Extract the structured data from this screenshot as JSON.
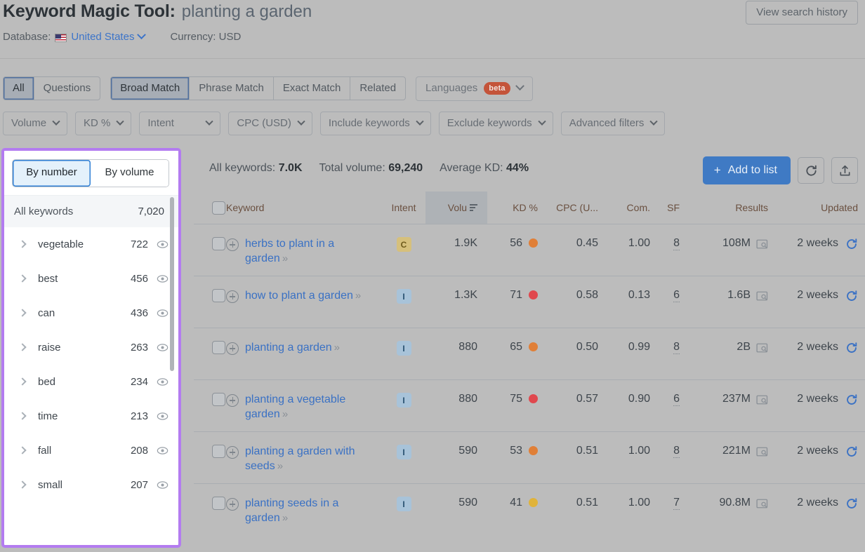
{
  "header": {
    "title_main": "Keyword Magic Tool:",
    "title_query": "planting a garden",
    "view_history_label": "View search history",
    "database_label": "Database:",
    "database_value": "United States",
    "currency_label": "Currency: USD"
  },
  "tabs": {
    "group1": [
      {
        "label": "All",
        "selected": true
      },
      {
        "label": "Questions",
        "selected": false
      }
    ],
    "group2": [
      {
        "label": "Broad Match",
        "selected": true
      },
      {
        "label": "Phrase Match",
        "selected": false
      },
      {
        "label": "Exact Match",
        "selected": false
      },
      {
        "label": "Related",
        "selected": false
      }
    ],
    "languages_label": "Languages",
    "languages_badge": "beta"
  },
  "filters": [
    {
      "label": "Volume"
    },
    {
      "label": "KD %"
    },
    {
      "label": "Intent"
    },
    {
      "label": "CPC (USD)"
    },
    {
      "label": "Include keywords"
    },
    {
      "label": "Exclude keywords"
    },
    {
      "label": "Advanced filters"
    }
  ],
  "sidebar": {
    "segments": [
      {
        "label": "By number",
        "active": true
      },
      {
        "label": "By volume",
        "active": false
      }
    ],
    "all_keywords_label": "All keywords",
    "all_keywords_count": "7,020",
    "groups": [
      {
        "name": "vegetable",
        "count": "722"
      },
      {
        "name": "best",
        "count": "456"
      },
      {
        "name": "can",
        "count": "436"
      },
      {
        "name": "raise",
        "count": "263"
      },
      {
        "name": "bed",
        "count": "234"
      },
      {
        "name": "time",
        "count": "213"
      },
      {
        "name": "fall",
        "count": "208"
      },
      {
        "name": "small",
        "count": "207"
      }
    ]
  },
  "summary": {
    "all_keywords_label": "All keywords:",
    "all_keywords_value": "7.0K",
    "total_volume_label": "Total volume:",
    "total_volume_value": "69,240",
    "average_kd_label": "Average KD:",
    "average_kd_value": "44%",
    "add_to_list_label": "Add to list",
    "plus": "+"
  },
  "table": {
    "columns": {
      "keyword": "Keyword",
      "intent": "Intent",
      "volume": "Volu",
      "kd": "KD %",
      "cpc": "CPC (U...",
      "com": "Com.",
      "sf": "SF",
      "results": "Results",
      "updated": "Updated"
    },
    "rows": [
      {
        "keyword": "herbs to plant in a garden",
        "intent": "C",
        "volume": "1.9K",
        "kd": "56",
        "kd_color": "#e07f37",
        "cpc": "0.45",
        "com": "1.00",
        "sf": "8",
        "results": "108M",
        "updated": "2 weeks"
      },
      {
        "keyword": "how to plant a garden",
        "intent": "I",
        "volume": "1.3K",
        "kd": "71",
        "kd_color": "#e0484e",
        "cpc": "0.58",
        "com": "0.13",
        "sf": "6",
        "results": "1.6B",
        "updated": "2 weeks"
      },
      {
        "keyword": "planting a garden",
        "intent": "I",
        "volume": "880",
        "kd": "65",
        "kd_color": "#e07f37",
        "cpc": "0.50",
        "com": "0.99",
        "sf": "8",
        "results": "2B",
        "updated": "2 weeks"
      },
      {
        "keyword": "planting a vegetable garden",
        "intent": "I",
        "volume": "880",
        "kd": "75",
        "kd_color": "#e0484e",
        "cpc": "0.57",
        "com": "0.90",
        "sf": "6",
        "results": "237M",
        "updated": "2 weeks"
      },
      {
        "keyword": "planting a garden with seeds",
        "intent": "I",
        "volume": "590",
        "kd": "53",
        "kd_color": "#e07f37",
        "cpc": "0.51",
        "com": "1.00",
        "sf": "8",
        "results": "221M",
        "updated": "2 weeks"
      },
      {
        "keyword": "planting seeds in a garden",
        "intent": "I",
        "volume": "590",
        "kd": "41",
        "kd_color": "#e0b33a",
        "cpc": "0.51",
        "com": "1.00",
        "sf": "7",
        "results": "90.8M",
        "updated": "2 weeks"
      }
    ],
    "keyword_arrows": "»"
  },
  "colors": {
    "accent_blue": "#3f7ac4",
    "highlight_purple": "#b37cf0",
    "beta_badge": "#c4543a"
  }
}
